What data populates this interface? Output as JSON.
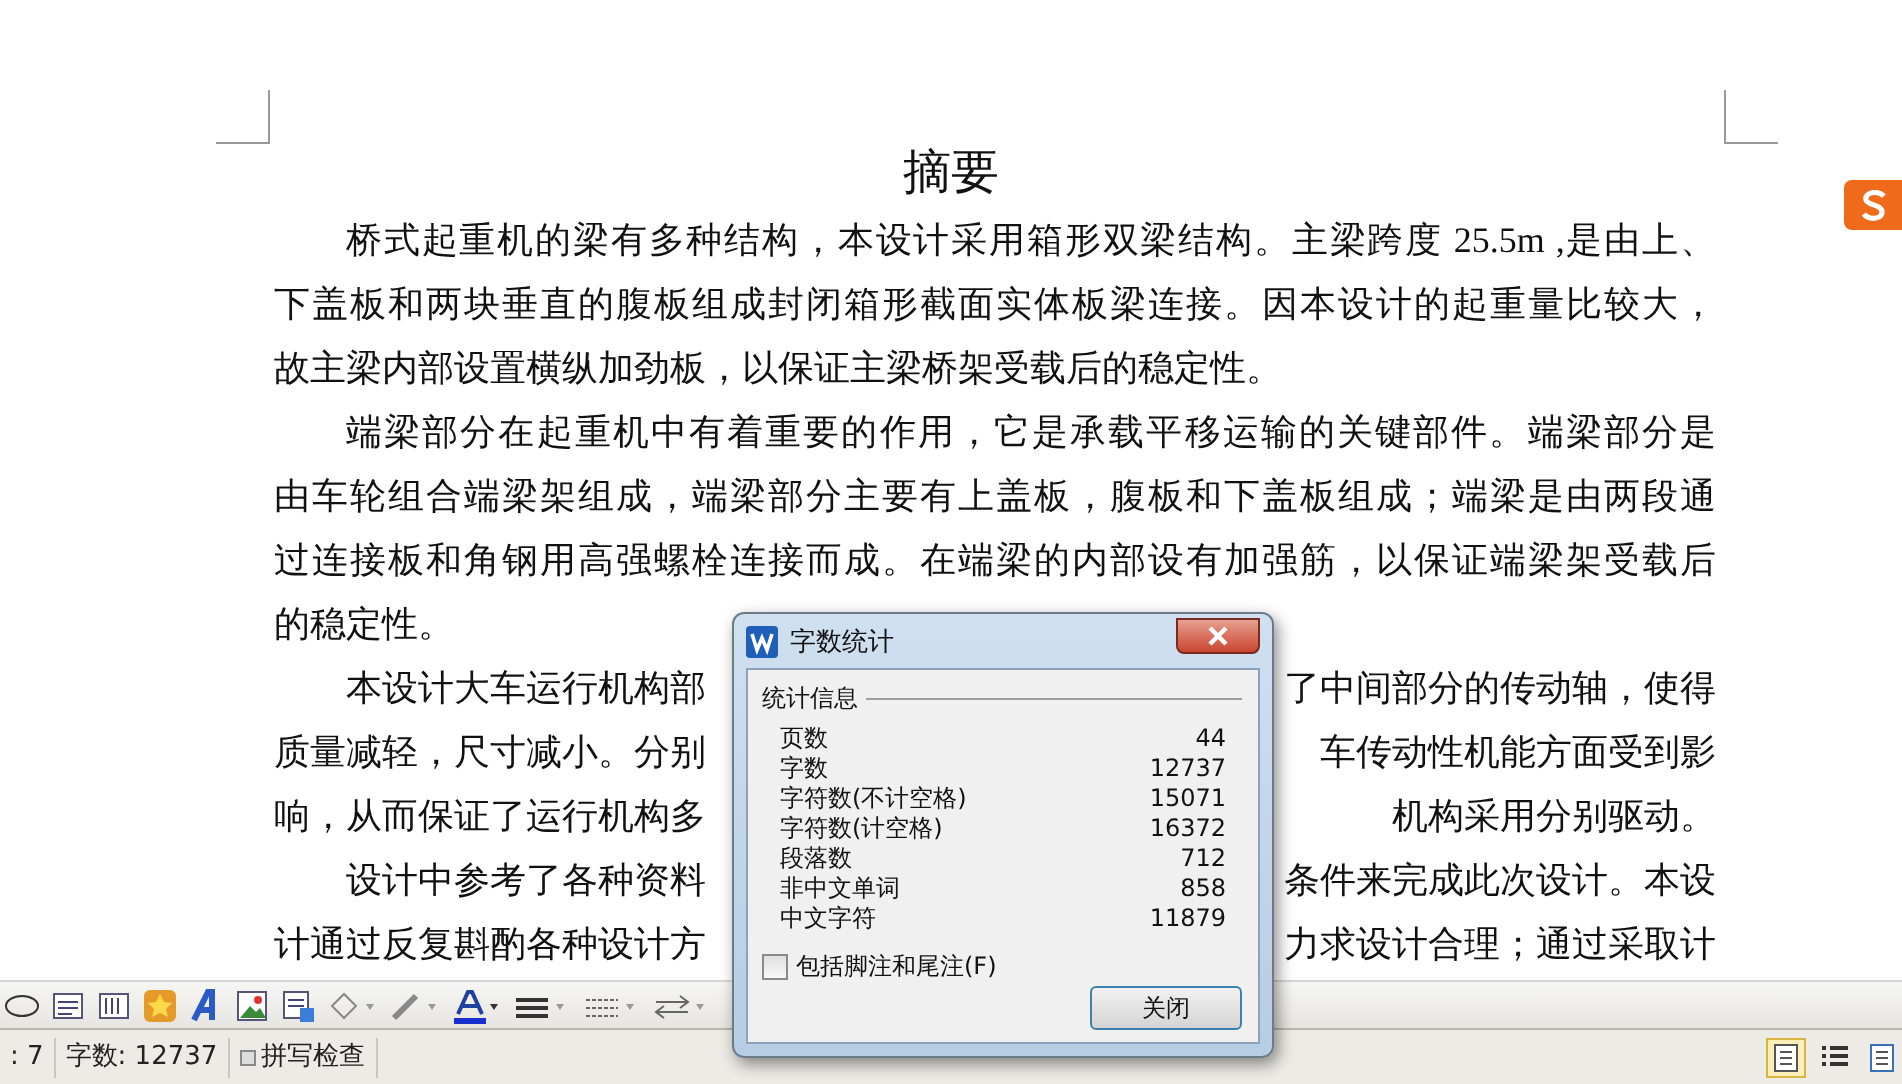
{
  "document": {
    "title": "摘要",
    "paragraphs": [
      {
        "lines": [
          {
            "kind": "full",
            "text": "桥式起重机的梁有多种结构，本设计采用箱形双梁结构。主梁跨度 25.5m ,是由上、"
          },
          {
            "kind": "full",
            "text": "下盖板和两块垂直的腹板组成封闭箱形截面实体板梁连接。因本设计的起重量比较大，"
          },
          {
            "kind": "last",
            "text": "故主梁内部设置横纵加劲板，以保证主梁桥架受载后的稳定性。"
          }
        ]
      },
      {
        "lines": [
          {
            "kind": "full",
            "text": "端梁部分在起重机中有着重要的作用，它是承载平移运输的关键部件。端梁部分是"
          },
          {
            "kind": "full",
            "text": "由车轮组合端梁架组成，端梁部分主要有上盖板，腹板和下盖板组成；端梁是由两段通"
          },
          {
            "kind": "full",
            "text": "过连接板和角钢用高强螺栓连接而成。在端梁的内部设有加强筋，以保证端梁架受载后"
          },
          {
            "kind": "last",
            "text": "的稳定性。"
          }
        ]
      },
      {
        "lines": [
          {
            "kind": "split",
            "left": "本设计大车运行机构部",
            "right": "了中间部分的传动轴，使得"
          },
          {
            "kind": "split",
            "left": "质量减轻，尺寸减小。分别",
            "right": "车传动性机能方面受到影"
          },
          {
            "kind": "split",
            "left": "响，从而保证了运行机构多",
            "right": "机构采用分别驱动。"
          }
        ]
      },
      {
        "lines": [
          {
            "kind": "split",
            "left": "设计中参考了各种资料",
            "right": "条件来完成此次设计。本设"
          },
          {
            "kind": "split",
            "left": "计通过反复斟酌各种设计方",
            "right": "力求设计合理；通过采取计"
          }
        ]
      }
    ]
  },
  "dialog": {
    "title": "字数统计",
    "group": "统计信息",
    "stats": [
      {
        "label": "页数",
        "value": "44"
      },
      {
        "label": "字数",
        "value": "12737"
      },
      {
        "label": "字符数(不计空格)",
        "value": "15071"
      },
      {
        "label": "字符数(计空格)",
        "value": "16372"
      },
      {
        "label": "段落数",
        "value": "712"
      },
      {
        "label": "非中文单词",
        "value": "858"
      },
      {
        "label": "中文字符",
        "value": "11879"
      }
    ],
    "checkbox": {
      "label": "包括脚注和尾注(F)",
      "checked": false
    },
    "button": "关闭"
  },
  "status_bar": {
    "items": [
      {
        "kind": "text",
        "text": ": 7"
      },
      {
        "kind": "text",
        "text": "字数: 12737"
      },
      {
        "kind": "toggle",
        "text": "拼写检查"
      }
    ],
    "views": [
      {
        "selected": true
      },
      {
        "selected": false
      },
      {
        "selected": false
      }
    ]
  }
}
